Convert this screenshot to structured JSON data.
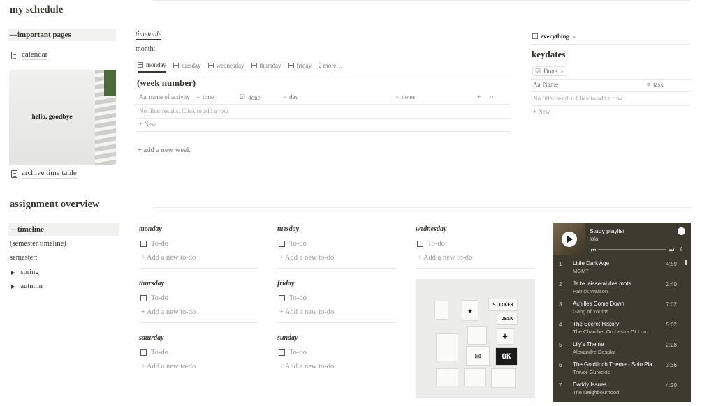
{
  "title": "my schedule",
  "sidebar": {
    "callout": "—important pages",
    "calendar_link": "calendar",
    "photo_text": "hello, goodbye",
    "archive_link": "archive time table"
  },
  "timetable": {
    "title": "timetable",
    "month_label": "month:",
    "tabs": [
      "monday",
      "tuesday",
      "wednesday",
      "thursday",
      "friday"
    ],
    "more": "2 more…",
    "heading": "(week number)",
    "columns": [
      "name of activity",
      "time",
      "done",
      "day",
      "notes"
    ],
    "plus": "+",
    "dots": "···",
    "empty": "No filter results. Click to add a row.",
    "new_label": "New",
    "add_week": "add a new week"
  },
  "keydates": {
    "view": "everything",
    "title": "keydates",
    "filter": "Done",
    "col_name": "Name",
    "col_task": "task",
    "empty": "No filter results. Click to add a row.",
    "new_label": "New"
  },
  "assignment": {
    "title": "assignment overview",
    "callout": "—timeline",
    "semester_timeline": "(semester timeline)",
    "semester_label": "semester:",
    "toggles": [
      "spring",
      "autumn"
    ]
  },
  "days": {
    "monday": "monday",
    "tuesday": "tuesday",
    "wednesday": "wednesday",
    "thursday": "thursday",
    "friday": "friday",
    "saturday": "saturday",
    "sunday": "sunday",
    "todo": "To-do",
    "add_todo": "Add a new to-do"
  },
  "stickers": {
    "sticker_label": "STICKER",
    "desk_label": "DESK",
    "ok_label": "OK"
  },
  "player": {
    "playlist": "Study playlist",
    "user": "lola",
    "tracks": [
      {
        "n": "1",
        "title": "Little Dark Age",
        "artist": "MGMT",
        "duration": "4:59"
      },
      {
        "n": "2",
        "title": "Je te laisserai des mots",
        "artist": "Patrick Watson",
        "duration": "2:40"
      },
      {
        "n": "3",
        "title": "Achilles Come Down",
        "artist": "Gang of Youths",
        "duration": "7:02"
      },
      {
        "n": "4",
        "title": "The Secret History",
        "artist": "The Chamber Orchestra Of Lon...",
        "duration": "5:02"
      },
      {
        "n": "5",
        "title": "Lily's Theme",
        "artist": "Alexandre Desplat",
        "duration": "2:28"
      },
      {
        "n": "6",
        "title": "The Goldfinch Theme - Solo Pia...",
        "artist": "Trevor Gureckis",
        "duration": "3:36"
      },
      {
        "n": "7",
        "title": "Daddy Issues",
        "artist": "The Neighbourhood",
        "duration": "4:20"
      }
    ]
  }
}
